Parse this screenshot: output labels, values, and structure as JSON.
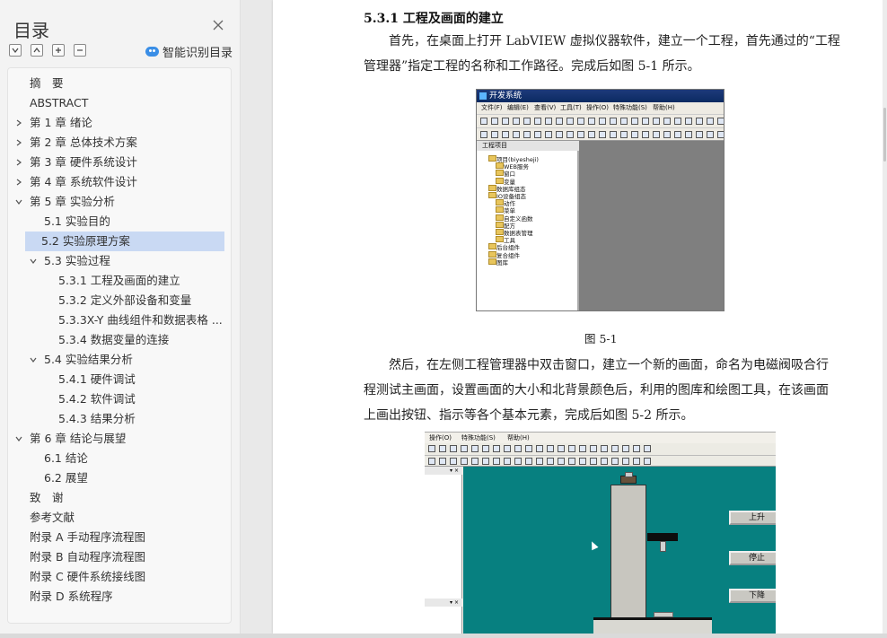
{
  "toc": {
    "title": "目录",
    "smart_label": "智能识别目录",
    "items": [
      {
        "label": "摘　要",
        "level": 0,
        "arrow": "none"
      },
      {
        "label": "ABSTRACT",
        "level": 0,
        "arrow": "none"
      },
      {
        "label": "第 1 章  绪论",
        "level": 0,
        "arrow": "right"
      },
      {
        "label": "第 2 章  总体技术方案",
        "level": 0,
        "arrow": "right"
      },
      {
        "label": "第 3 章  硬件系统设计",
        "level": 0,
        "arrow": "right"
      },
      {
        "label": "第 4 章  系统软件设计",
        "level": 0,
        "arrow": "right"
      },
      {
        "label": "第 5 章  实验分析",
        "level": 0,
        "arrow": "down"
      },
      {
        "label": "5.1 实验目的",
        "level": 1,
        "arrow": "none"
      },
      {
        "label": "5.2 实验原理方案",
        "level": 1,
        "arrow": "none",
        "selected": true
      },
      {
        "label": "5.3 实验过程",
        "level": 1,
        "arrow": "down"
      },
      {
        "label": "5.3.1 工程及画面的建立",
        "level": 2,
        "arrow": "none"
      },
      {
        "label": "5.3.2 定义外部设备和变量",
        "level": 2,
        "arrow": "none"
      },
      {
        "label": "5.3.3X-Y 曲线组件和数据表格 ...",
        "level": 2,
        "arrow": "none"
      },
      {
        "label": "5.3.4 数据变量的连接",
        "level": 2,
        "arrow": "none"
      },
      {
        "label": "5.4 实验结果分析",
        "level": 1,
        "arrow": "down"
      },
      {
        "label": "5.4.1 硬件调试",
        "level": 2,
        "arrow": "none"
      },
      {
        "label": "5.4.2 软件调试",
        "level": 2,
        "arrow": "none"
      },
      {
        "label": "5.4.3 结果分析",
        "level": 2,
        "arrow": "none"
      },
      {
        "label": "第 6 章  结论与展望",
        "level": 0,
        "arrow": "down"
      },
      {
        "label": "6.1 结论",
        "level": 1,
        "arrow": "none"
      },
      {
        "label": "6.2 展望",
        "level": 1,
        "arrow": "none"
      },
      {
        "label": "致　谢",
        "level": 0,
        "arrow": "none"
      },
      {
        "label": "参考文献",
        "level": 0,
        "arrow": "none"
      },
      {
        "label": "附录 A  手动程序流程图",
        "level": 0,
        "arrow": "none"
      },
      {
        "label": "附录 B  自动程序流程图",
        "level": 0,
        "arrow": "none"
      },
      {
        "label": "附录 C  硬件系统接线图",
        "level": 0,
        "arrow": "none"
      },
      {
        "label": "附录 D  系统程序",
        "level": 0,
        "arrow": "none"
      }
    ]
  },
  "doc": {
    "heading": "5.3.1 工程及画面的建立",
    "para1_line1": "首先，在桌面上打开 LabVIEW 虚拟仪器软件，建立一个工程，首先通过的“工程",
    "para1_line2": "管理器”指定工程的名称和工作路径。完成后如图 5-1 所示。",
    "caption1": "图 5-1",
    "para2_line1": "然后，在左侧工程管理器中双击窗口，建立一个新的画面，命名为电磁阀吸合行",
    "para2_line2": "程测试主画面，设置画面的大小和北背景颜色后，利用的图库和绘图工具，在该画面",
    "para2_line3": "上画出按钮、指示等各个基本元素，完成后如图 5-2 所示。"
  },
  "figure1": {
    "window_title": "开发系统",
    "menu": [
      "文件(F)",
      "编辑(E)",
      "查看(V)",
      "工具(T)",
      "操作(O)",
      "特殊功能(S)",
      "帮助(H)"
    ],
    "panel_title": "工程项目",
    "tree": [
      "项目(biyesheji)",
      "WEB服务",
      "窗口",
      "变量",
      "数据库组态",
      "IO设备组态",
      "动作",
      "菜单",
      "自定义函数",
      "配方",
      "数据表管理",
      "工具",
      "后台组件",
      "复合组件",
      "图库"
    ]
  },
  "figure2": {
    "menu": [
      "操作(O)",
      "特殊功能(S)",
      "帮助(H)"
    ],
    "buttons": [
      "上升",
      "停止",
      "下降"
    ]
  }
}
